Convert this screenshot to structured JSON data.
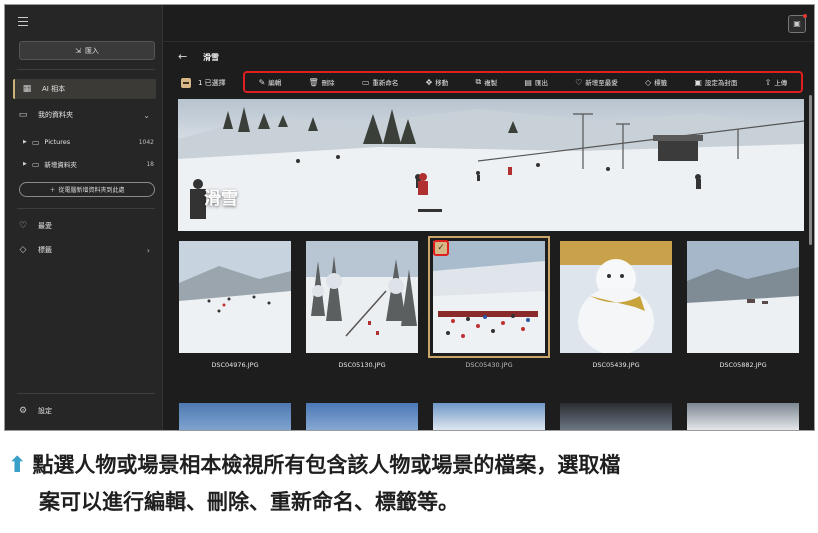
{
  "sidebar": {
    "import_label": "匯入",
    "ai_album": "AI 相本",
    "my_folders": "我的資料夾",
    "folders": [
      {
        "name": "Pictures",
        "count": "1042"
      },
      {
        "name": "新增資料夾",
        "count": "18"
      }
    ],
    "add_folder": "從電腦新增資料夾到此處",
    "favorites": "最愛",
    "tags": "標籤",
    "settings": "設定"
  },
  "album": {
    "title": "滑雪",
    "selected_count": "1 已選擇",
    "hero_title": "滑雪"
  },
  "toolbar": {
    "items": [
      {
        "icon": "edit-icon",
        "glyph": "✎",
        "label": "編輯"
      },
      {
        "icon": "delete-icon",
        "glyph": "🗑",
        "label": "刪除"
      },
      {
        "icon": "rename-icon",
        "glyph": "▭",
        "label": "重新命名"
      },
      {
        "icon": "move-icon",
        "glyph": "✥",
        "label": "移動"
      },
      {
        "icon": "copy-icon",
        "glyph": "⧉",
        "label": "複製"
      },
      {
        "icon": "export-icon",
        "glyph": "▤",
        "label": "匯出"
      },
      {
        "icon": "heart-icon",
        "glyph": "♡",
        "label": "新增至最愛"
      },
      {
        "icon": "tag-icon",
        "glyph": "◇",
        "label": "標籤"
      },
      {
        "icon": "cover-icon",
        "glyph": "▣",
        "label": "設定為封面"
      },
      {
        "icon": "upload-icon",
        "glyph": "⇧",
        "label": "上傳"
      }
    ]
  },
  "photos": [
    {
      "file": "DSC04976.JPG",
      "selected": false
    },
    {
      "file": "DSC05130.JPG",
      "selected": false
    },
    {
      "file": "DSC05430.JPG",
      "selected": true
    },
    {
      "file": "DSC05439.JPG",
      "selected": false
    },
    {
      "file": "DSC05882.JPG",
      "selected": false
    }
  ],
  "caption": {
    "line1": "點選人物或場景相本檢視所有包含該人物或場景的檔案，選取檔",
    "line2": "案可以進行編輯、刪除、重新命名、標籤等。"
  },
  "colors": {
    "accent": "#d8b887",
    "highlight": "#e0201f",
    "caption_arrow": "#39a0c9"
  }
}
